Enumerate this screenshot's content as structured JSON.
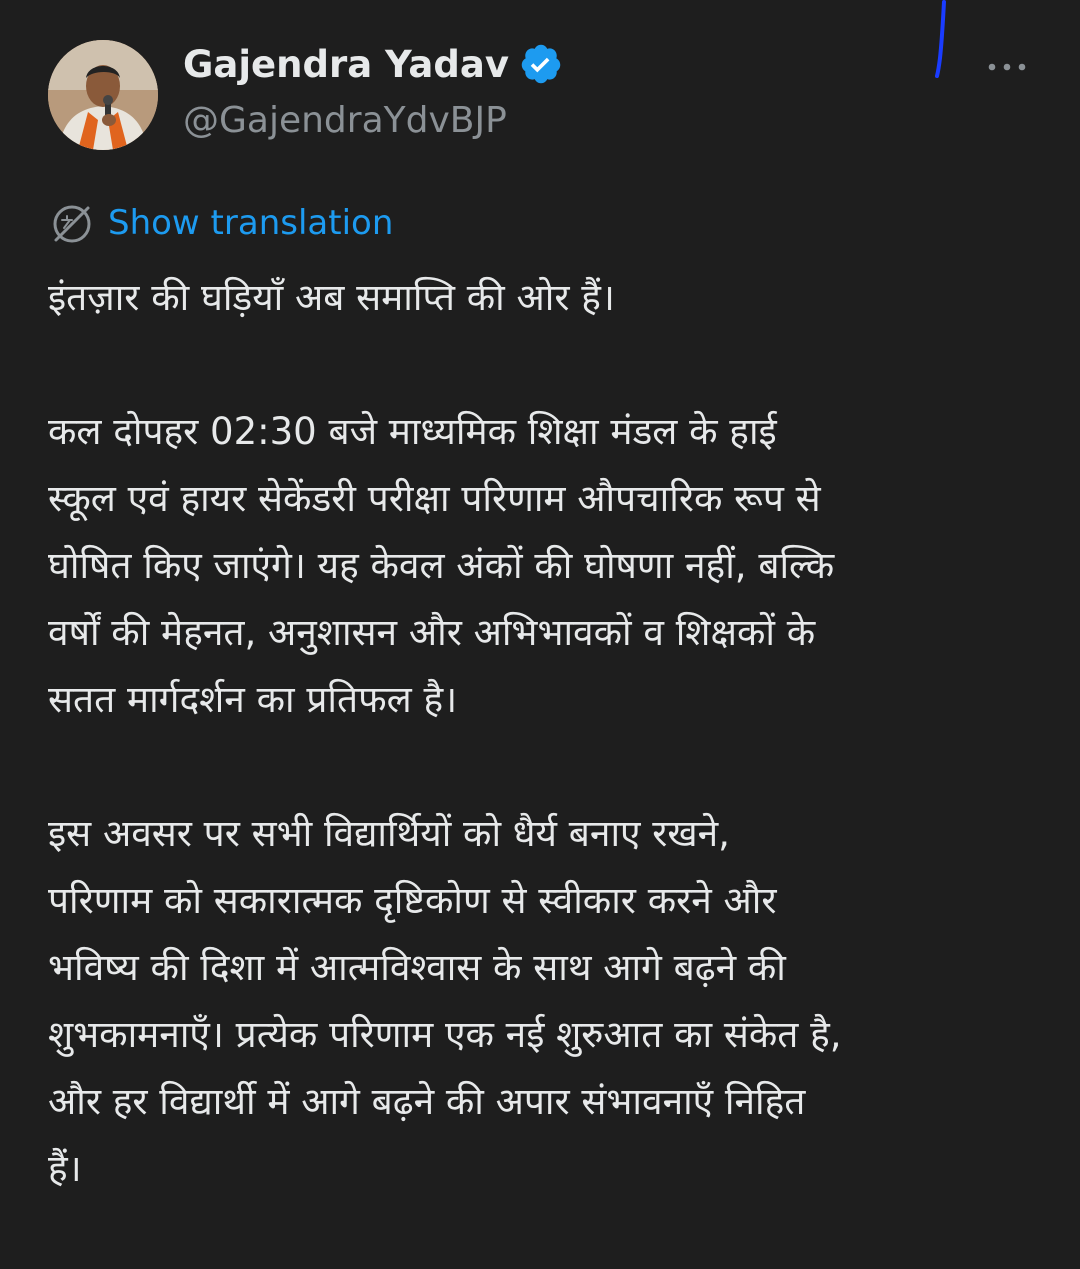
{
  "author": {
    "display_name": "Gajendra Yadav",
    "handle": "@GajendraYdvBJP",
    "verified": true,
    "avatar_icon": "profile-photo"
  },
  "actions": {
    "more_icon": "more-options-icon"
  },
  "translation": {
    "label": "Show translation",
    "icon": "translate-icon",
    "color": "#1d9bf0"
  },
  "tweet": {
    "paragraphs": [
      {
        "lines": [
          "इंतज़ार की घड़ियाँ अब समाप्ति की ओर हैं।"
        ]
      },
      {
        "lines": [
          "कल दोपहर 02:30 बजे माध्यमिक शिक्षा मंडल के हाई",
          "स्कूल एवं हायर सेकेंडरी परीक्षा परिणाम औपचारिक रूप से",
          "घोषित किए जाएंगे। यह केवल अंकों की घोषणा नहीं, बल्कि",
          "वर्षों की मेहनत, अनुशासन और अभिभावकों व शिक्षकों के",
          "सतत मार्गदर्शन का प्रतिफल है।"
        ]
      },
      {
        "lines": [
          "इस अवसर पर सभी विद्यार्थियों को धैर्य बनाए रखने,",
          "परिणाम को सकारात्मक दृष्टिकोण से स्वीकार करने और",
          "भविष्य की दिशा में आत्मविश्वास के साथ आगे बढ़ने की",
          "शुभकामनाएँ। प्रत्येक परिणाम एक नई शुरुआत का संकेत है,",
          "और हर विद्यार्थी में आगे बढ़ने की अपार संभावनाएँ निहित",
          "हैं।"
        ]
      }
    ]
  },
  "colors": {
    "background": "#1e1e1e",
    "text": "#e7e9ea",
    "secondary_text": "#8b9196",
    "verified_badge": "#1d9bf0",
    "scribble": "#1a3cff"
  }
}
